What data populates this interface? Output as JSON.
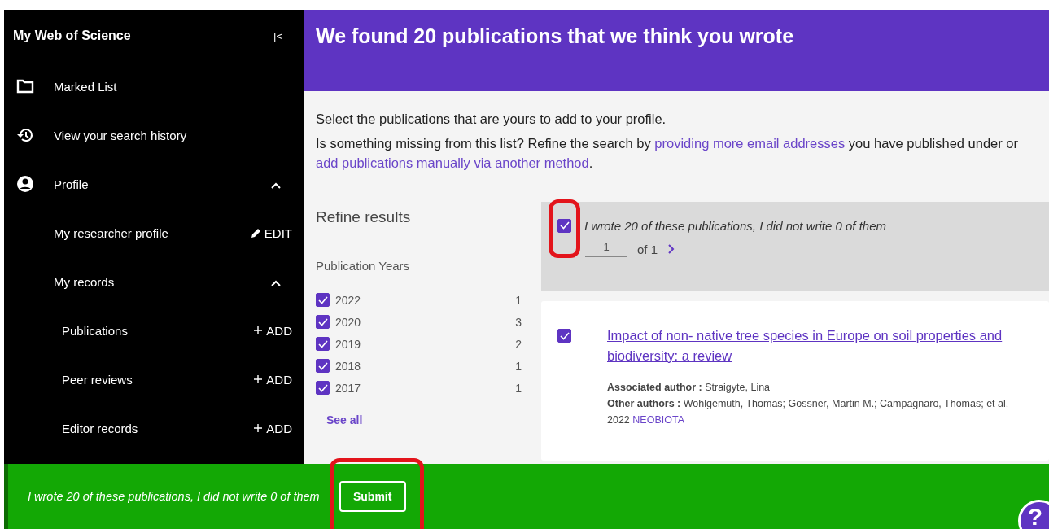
{
  "sidebar": {
    "title": "My Web of Science",
    "collapse_icon": "|<",
    "items": [
      {
        "kind": "folder",
        "label": "Marked List"
      },
      {
        "kind": "history",
        "label": "View your search history"
      },
      {
        "kind": "profile",
        "label": "Profile",
        "expanded": true,
        "children": [
          {
            "label": "My researcher profile",
            "action": "EDIT",
            "kind": "edit"
          },
          {
            "label": "My records",
            "expanded": true,
            "children": [
              {
                "label": "Publications",
                "action": "ADD",
                "kind": "add"
              },
              {
                "label": "Peer reviews",
                "action": "ADD",
                "kind": "add"
              },
              {
                "label": "Editor records",
                "action": "ADD",
                "kind": "add"
              }
            ]
          }
        ]
      }
    ]
  },
  "header": {
    "title": "We found 20 publications that we think you wrote"
  },
  "intro": {
    "line": "Select the publications that are yours to add to your profile.",
    "prefix": "Is something missing from this list? Refine the search by ",
    "link1": "providing more email addresses",
    "middle": " you have published under or ",
    "link2": "add publications manually via another method",
    "suffix": "."
  },
  "refine": {
    "title": "Refine results",
    "section": "Publication Years",
    "years": [
      {
        "label": "2022",
        "count": "1",
        "checked": true
      },
      {
        "label": "2020",
        "count": "3",
        "checked": true
      },
      {
        "label": "2019",
        "count": "2",
        "checked": true
      },
      {
        "label": "2018",
        "count": "1",
        "checked": true
      },
      {
        "label": "2017",
        "count": "1",
        "checked": true
      }
    ],
    "see_all": "See all"
  },
  "select_bar": {
    "checked": true,
    "highlighted": true,
    "label": "I wrote 20 of these publications, I did not write 0 of them",
    "page": "1",
    "of": "of 1"
  },
  "publications": [
    {
      "checked": true,
      "title": "Impact of non- native tree species in Europe on soil properties and biodiversity: a review",
      "associated_label": "Associated author :",
      "associated": " Straigyte, Lina",
      "other_label": "Other authors :",
      "other": " Wohlgemuth, Thomas; Gossner, Martin M.; Campagnaro, Thomas; et al.",
      "year": "2022",
      "journal": "NEOBIOTA"
    }
  ],
  "footer": {
    "label": "I wrote 20 of these publications, I did not write 0 of them",
    "button": "Submit",
    "button_highlighted": true,
    "help": "?"
  }
}
